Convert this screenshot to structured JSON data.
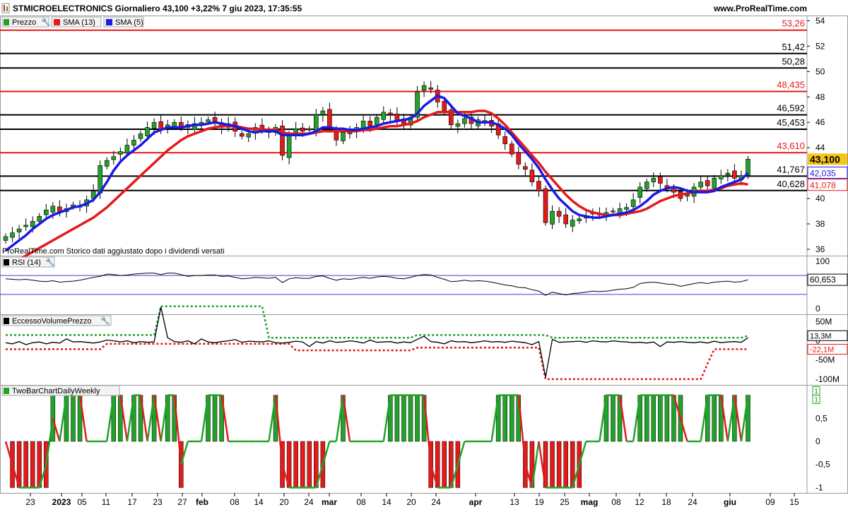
{
  "header": {
    "title": "STMICROELECTRONICS Giornaliero 43,100 +3,22% 7 giu 2023, 17:35:55",
    "site": "www.ProRealTime.com"
  },
  "legend_main": {
    "price": "Prezzo",
    "sma13": "SMA (13)",
    "sma5": "SMA (5)"
  },
  "note": "ProRealTime.com  Storico dati aggiustato dopo i dividendi versati",
  "panels": {
    "rsi": {
      "label": "RSI (14)",
      "value_label": "60,653"
    },
    "evp": {
      "label": "EccessoVolumePrezzo",
      "labels": [
        "13,3M",
        "-22,1M"
      ]
    },
    "tbc": {
      "label": "TwoBarChartDailyWeekly",
      "labels": [
        "1",
        "1"
      ]
    }
  },
  "colors": {
    "up": "#22a22a",
    "down": "#e41a1a",
    "sma13": "#e41a1a",
    "sma5": "#1a1ae4",
    "last": "#f5c518"
  },
  "chart_data": [
    {
      "type": "candlestick",
      "title": "STMICROELECTRONICS Giornaliero",
      "x_ticks": [
        "23",
        "2023",
        "05",
        "11",
        "17",
        "23",
        "27",
        "feb",
        "08",
        "14",
        "20",
        "24",
        "mar",
        "08",
        "14",
        "20",
        "24",
        "apr",
        "13",
        "19",
        "25",
        "mag",
        "08",
        "12",
        "18",
        "24",
        "giu",
        "09",
        "15"
      ],
      "ylim": [
        35.5,
        54.3
      ],
      "y_ticks": [
        "36",
        "38",
        "40",
        "42",
        "44",
        "46",
        "48",
        "50",
        "52",
        "54"
      ],
      "levels": [
        {
          "value": 53.26,
          "label": "53,26",
          "color": "red"
        },
        {
          "value": 51.42,
          "label": "51,42",
          "color": "black"
        },
        {
          "value": 50.28,
          "label": "50,28",
          "color": "black"
        },
        {
          "value": 48.435,
          "label": "48,435",
          "color": "red"
        },
        {
          "value": 46.592,
          "label": "46,592",
          "color": "black"
        },
        {
          "value": 45.453,
          "label": "45,453",
          "color": "black"
        },
        {
          "value": 43.61,
          "label": "43,610",
          "color": "red"
        },
        {
          "value": 41.767,
          "label": "41,767",
          "color": "black"
        },
        {
          "value": 40.628,
          "label": "40,628",
          "color": "black"
        }
      ],
      "last_price": {
        "value": 43.1,
        "label": "43,100"
      },
      "sma5_last": {
        "value": 42.035,
        "label": "42,035"
      },
      "sma13_last": {
        "value": 41.078,
        "label": "41,078"
      },
      "close": [
        37.0,
        37.3,
        37.6,
        37.9,
        38.2,
        38.6,
        39.1,
        39.4,
        38.9,
        39.2,
        39.5,
        39.4,
        39.9,
        40.6,
        42.6,
        43.0,
        43.3,
        43.7,
        44.2,
        44.6,
        45.1,
        45.6,
        46.0,
        45.4,
        45.8,
        46.0,
        45.7,
        45.6,
        45.9,
        46.0,
        46.2,
        46.1,
        45.6,
        45.9,
        45.3,
        44.9,
        45.1,
        45.6,
        45.4,
        45.2,
        45.6,
        43.4,
        45.0,
        45.5,
        45.3,
        45.4,
        46.6,
        46.9,
        45.5,
        44.6,
        45.2,
        45.1,
        45.6,
        46.1,
        45.7,
        46.4,
        46.8,
        46.6,
        46.1,
        45.9,
        46.4,
        48.4,
        48.9,
        48.6,
        47.6,
        46.8,
        45.8,
        45.9,
        46.3,
        45.9,
        46.2,
        46.1,
        45.7,
        45.0,
        44.3,
        43.5,
        42.7,
        42.3,
        41.3,
        40.6,
        38.1,
        39.0,
        38.6,
        38.0,
        38.3,
        38.4,
        38.6,
        38.9,
        38.7,
        38.9,
        39.0,
        39.2,
        39.3,
        39.9,
        40.9,
        41.3,
        41.6,
        41.2,
        40.8,
        40.5,
        40.0,
        40.3,
        40.9,
        41.3,
        41.0,
        41.6,
        41.8,
        42.0,
        41.6,
        41.8,
        43.1
      ],
      "sma5": [
        35.9,
        36.3,
        36.7,
        37.1,
        37.6,
        38.0,
        38.4,
        38.7,
        38.9,
        39.1,
        39.3,
        39.4,
        39.6,
        39.9,
        40.5,
        41.3,
        42.2,
        42.9,
        43.4,
        43.8,
        44.2,
        44.7,
        45.2,
        45.4,
        45.6,
        45.6,
        45.6,
        45.7,
        45.8,
        45.8,
        45.9,
        46.0,
        45.9,
        45.8,
        45.7,
        45.5,
        45.3,
        45.2,
        45.3,
        45.3,
        45.3,
        45.0,
        45.0,
        45.0,
        45.0,
        45.1,
        45.3,
        45.6,
        45.6,
        45.5,
        45.5,
        45.4,
        45.4,
        45.5,
        45.6,
        45.7,
        45.9,
        46.0,
        46.1,
        46.2,
        46.3,
        46.7,
        47.3,
        47.7,
        48.1,
        47.9,
        47.3,
        46.7,
        46.5,
        46.3,
        46.0,
        46.0,
        46.0,
        45.8,
        45.5,
        45.0,
        44.3,
        43.7,
        43.1,
        42.4,
        41.5,
        40.7,
        40.0,
        39.5,
        39.0,
        38.7,
        38.6,
        38.5,
        38.5,
        38.6,
        38.7,
        38.8,
        38.9,
        39.1,
        39.4,
        39.8,
        40.3,
        40.6,
        40.8,
        40.9,
        40.8,
        40.6,
        40.5,
        40.5,
        40.5,
        40.6,
        40.9,
        41.1,
        41.3,
        41.5,
        42.0
      ],
      "sma13": [
        null,
        35.0,
        35.2,
        35.5,
        35.8,
        36.1,
        36.4,
        36.7,
        37.0,
        37.3,
        37.6,
        37.9,
        38.2,
        38.5,
        38.9,
        39.3,
        39.8,
        40.3,
        40.8,
        41.3,
        41.8,
        42.3,
        42.8,
        43.3,
        43.8,
        44.2,
        44.6,
        44.9,
        45.1,
        45.3,
        45.5,
        45.6,
        45.7,
        45.7,
        45.7,
        45.6,
        45.5,
        45.5,
        45.4,
        45.4,
        45.4,
        45.2,
        45.1,
        45.1,
        45.1,
        45.1,
        45.2,
        45.3,
        45.3,
        45.3,
        45.3,
        45.3,
        45.3,
        45.4,
        45.4,
        45.5,
        45.6,
        45.7,
        45.7,
        45.8,
        45.9,
        46.1,
        46.4,
        46.6,
        46.8,
        46.8,
        46.8,
        46.8,
        46.8,
        46.8,
        46.9,
        46.9,
        46.7,
        46.3,
        45.8,
        45.2,
        44.6,
        44.0,
        43.4,
        42.8,
        42.1,
        41.5,
        40.9,
        40.3,
        39.8,
        39.4,
        39.1,
        38.9,
        38.8,
        38.7,
        38.7,
        38.7,
        38.8,
        38.9,
        39.0,
        39.2,
        39.5,
        39.8,
        40.0,
        40.2,
        40.3,
        40.4,
        40.5,
        40.6,
        40.6,
        40.7,
        40.8,
        41.0,
        41.1,
        41.2,
        41.1
      ]
    },
    {
      "type": "line",
      "title": "RSI (14)",
      "ylim": [
        0,
        100
      ],
      "y_ticks": [
        "0",
        "100"
      ],
      "levels": [
        70,
        30
      ],
      "values": [
        63,
        62,
        61,
        62,
        60,
        58,
        57,
        59,
        56,
        57,
        58,
        60,
        63,
        66,
        68,
        73,
        72,
        70,
        71,
        73,
        74,
        75,
        75,
        72,
        75,
        75,
        72,
        68,
        70,
        70,
        71,
        71,
        68,
        69,
        66,
        63,
        64,
        66,
        65,
        64,
        66,
        55,
        63,
        65,
        64,
        64,
        68,
        69,
        64,
        60,
        63,
        62,
        64,
        66,
        64,
        67,
        68,
        67,
        64,
        63,
        66,
        70,
        72,
        71,
        66,
        62,
        57,
        58,
        60,
        58,
        59,
        58,
        56,
        53,
        50,
        48,
        45,
        44,
        40,
        37,
        28,
        35,
        32,
        29,
        32,
        33,
        35,
        37,
        36,
        37,
        39,
        41,
        42,
        45,
        53,
        55,
        56,
        54,
        52,
        51,
        47,
        50,
        53,
        55,
        53,
        56,
        57,
        58,
        56,
        57,
        61
      ]
    },
    {
      "type": "line",
      "title": "EccessoVolumePrezzo",
      "y_ticks": [
        "50M",
        "0",
        "-50M",
        "-100M"
      ],
      "ylim": [
        -115,
        60
      ],
      "values": [
        -5,
        -8,
        -2,
        -10,
        -5,
        -3,
        -8,
        -4,
        -6,
        5,
        -3,
        -2,
        -4,
        -6,
        -3,
        2,
        0,
        -3,
        0,
        -5,
        -2,
        -4,
        -3,
        88,
        8,
        -2,
        -4,
        0,
        -8,
        5,
        -3,
        -5,
        -2,
        0,
        3,
        -4,
        -1,
        -2,
        -3,
        0,
        -5,
        -6,
        -4,
        -1,
        -3,
        -15,
        -2,
        -6,
        0,
        -4,
        -3,
        0,
        -2,
        -6,
        2,
        -4,
        -3,
        -2,
        -6,
        -3,
        -5,
        4,
        12,
        -2,
        -4,
        -8,
        0,
        -3,
        -2,
        -5,
        -3,
        0,
        -3,
        -2,
        -4,
        -1,
        -3,
        -5,
        -10,
        -2,
        -95,
        4,
        -4,
        -3,
        -2,
        -1,
        -4,
        0,
        -2,
        -3,
        0,
        -2,
        -3,
        -5,
        -4,
        -6,
        -3,
        -15,
        -3,
        -4,
        -2,
        -4,
        -5,
        -3,
        -6,
        -1,
        -5,
        -3,
        -2,
        -4,
        8
      ],
      "upper_band": [
        15,
        15,
        15,
        15,
        15,
        15,
        15,
        15,
        15,
        15,
        15,
        15,
        15,
        15,
        15,
        15,
        15,
        15,
        15,
        15,
        15,
        15,
        15,
        90,
        90,
        90,
        90,
        90,
        90,
        90,
        90,
        90,
        90,
        90,
        90,
        90,
        90,
        90,
        90,
        8,
        8,
        8,
        8,
        8,
        8,
        8,
        8,
        8,
        8,
        8,
        8,
        8,
        8,
        8,
        8,
        8,
        8,
        8,
        8,
        8,
        8,
        15,
        15,
        15,
        15,
        15,
        15,
        15,
        15,
        15,
        15,
        15,
        15,
        15,
        15,
        15,
        15,
        15,
        15,
        15,
        15,
        8,
        8,
        8,
        8,
        8,
        8,
        8,
        8,
        8,
        8,
        8,
        8,
        8,
        8,
        8,
        8,
        8,
        8,
        8,
        8,
        8,
        8,
        8,
        8,
        8,
        8,
        8,
        8,
        8,
        13
      ],
      "lower_band": [
        -22,
        -22,
        -22,
        -22,
        -22,
        -22,
        -22,
        -22,
        -22,
        -22,
        -22,
        -22,
        -22,
        -22,
        -22,
        -8,
        -8,
        -8,
        -8,
        -8,
        -8,
        -8,
        -8,
        -8,
        -8,
        -8,
        -8,
        -8,
        -8,
        -8,
        -8,
        -8,
        -8,
        -8,
        -8,
        -8,
        -8,
        -8,
        -8,
        -8,
        -8,
        -8,
        -8,
        -25,
        -25,
        -25,
        -25,
        -25,
        -25,
        -25,
        -25,
        -25,
        -25,
        -25,
        -25,
        -25,
        -25,
        -25,
        -25,
        -25,
        -25,
        -18,
        -18,
        -18,
        -18,
        -18,
        -18,
        -18,
        -18,
        -18,
        -18,
        -18,
        -18,
        -18,
        -18,
        -18,
        -18,
        -18,
        -18,
        -18,
        -100,
        -100,
        -100,
        -100,
        -100,
        -100,
        -100,
        -100,
        -100,
        -100,
        -100,
        -100,
        -100,
        -100,
        -100,
        -100,
        -100,
        -100,
        -100,
        -100,
        -100,
        -100,
        -100,
        -100,
        -60,
        -22,
        -22,
        -22,
        -22,
        -22,
        -22
      ]
    },
    {
      "type": "bar",
      "title": "TwoBarChartDailyWeekly",
      "ylim": [
        -1.1,
        1.1
      ],
      "y_ticks": [
        "1",
        "0,5",
        "0",
        "-0,5",
        "-1"
      ],
      "bars": [
        0,
        -1,
        -1,
        -1,
        -1,
        -1,
        -1,
        1,
        0,
        1,
        1,
        1,
        0,
        0,
        0,
        0,
        1,
        1,
        0,
        1,
        1,
        0,
        1,
        0,
        1,
        1,
        -1,
        0,
        0,
        0,
        1,
        1,
        1,
        0,
        0,
        0,
        0,
        0,
        0,
        0,
        1,
        -1,
        -1,
        -1,
        -1,
        -1,
        -1,
        -1,
        0,
        0,
        1,
        0,
        0,
        0,
        0,
        0,
        0,
        1,
        1,
        1,
        1,
        1,
        1,
        -1,
        -1,
        -1,
        -1,
        -1,
        0,
        0,
        0,
        0,
        0,
        1,
        1,
        1,
        1,
        -1,
        -1,
        0,
        -1,
        -1,
        -1,
        -1,
        -1,
        -1,
        0,
        0,
        0,
        1,
        1,
        1,
        0,
        0,
        1,
        1,
        1,
        1,
        1,
        1,
        1,
        0,
        0,
        0,
        1,
        1,
        1,
        0,
        1,
        0,
        1
      ],
      "line": [
        0,
        -0.5,
        -1,
        -1,
        -1,
        -1,
        -0.5,
        0.5,
        0,
        1,
        1,
        1,
        0,
        0,
        0,
        0,
        1,
        1,
        0,
        1,
        1,
        0,
        1,
        0,
        1,
        1,
        -0.5,
        0,
        0,
        0,
        1,
        1,
        1,
        0,
        0,
        0,
        0,
        0,
        0,
        0,
        1,
        -0.5,
        -1,
        -1,
        -1,
        -1,
        -1,
        -0.5,
        0,
        0,
        1,
        0,
        0,
        0,
        0,
        0,
        0,
        1,
        1,
        1,
        1,
        1,
        1,
        -0.5,
        -1,
        -1,
        -1,
        -0.5,
        0,
        0,
        0,
        0,
        0,
        1,
        1,
        1,
        1,
        -0.5,
        -1,
        0,
        -1,
        -1,
        -1,
        -1,
        -1,
        -0.5,
        0,
        0,
        0,
        1,
        1,
        1,
        0,
        0,
        1,
        1,
        1,
        1,
        1,
        1,
        0.5,
        0,
        0,
        0,
        1,
        1,
        1,
        0,
        1,
        0,
        1
      ]
    }
  ]
}
